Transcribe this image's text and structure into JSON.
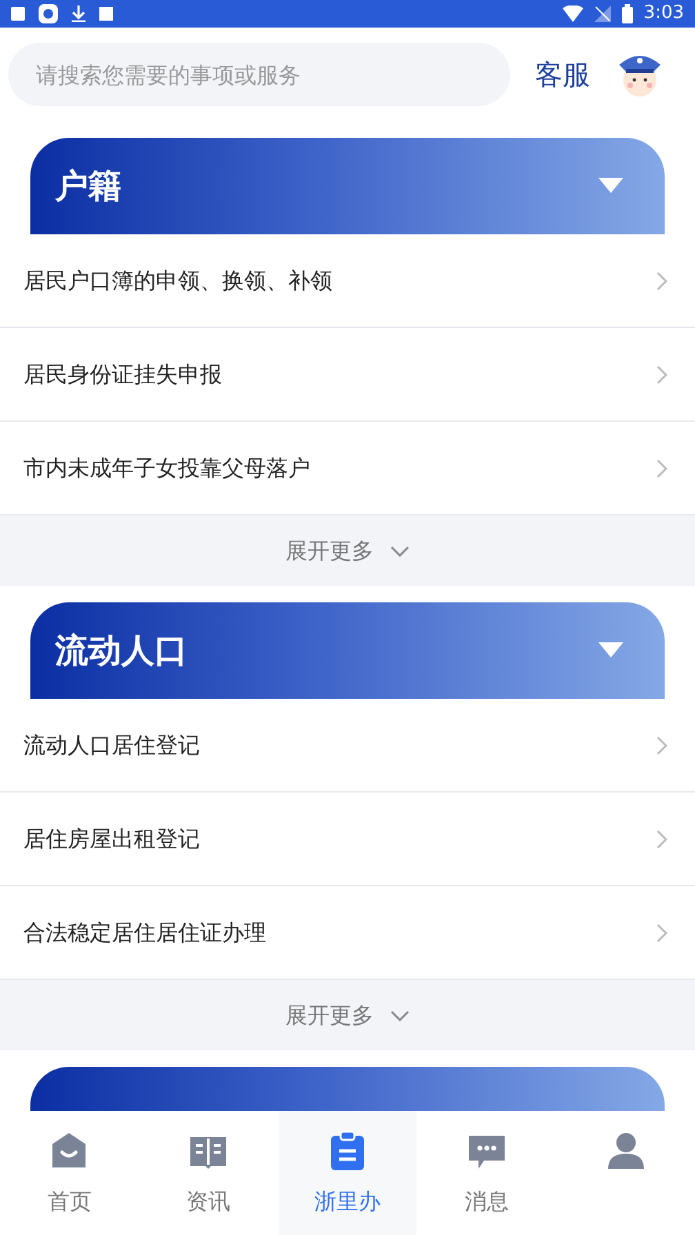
{
  "status_bar": {
    "time": "3:03"
  },
  "search": {
    "placeholder": "请搜索您需要的事项或服务"
  },
  "service_link": "客服",
  "sections": [
    {
      "kind": "full",
      "title": "户籍",
      "items": [
        "居民户口簿的申领、换领、补领",
        "居民身份证挂失申报",
        "市内未成年子女投靠父母落户"
      ],
      "more": "展开更多"
    },
    {
      "kind": "full",
      "title": "流动人口",
      "items": [
        "流动人口居住登记",
        "居住房屋出租登记",
        "合法稳定居住居住证办理"
      ],
      "more": "展开更多"
    },
    {
      "kind": "cut"
    }
  ],
  "nav": [
    {
      "kind": "home",
      "label": "首页",
      "selected": false
    },
    {
      "kind": "news",
      "label": "资讯",
      "selected": false
    },
    {
      "kind": "tasks",
      "label": "浙里办",
      "selected": true
    },
    {
      "kind": "messages",
      "label": "消息",
      "selected": false
    },
    {
      "kind": "profile",
      "selected": false
    }
  ]
}
